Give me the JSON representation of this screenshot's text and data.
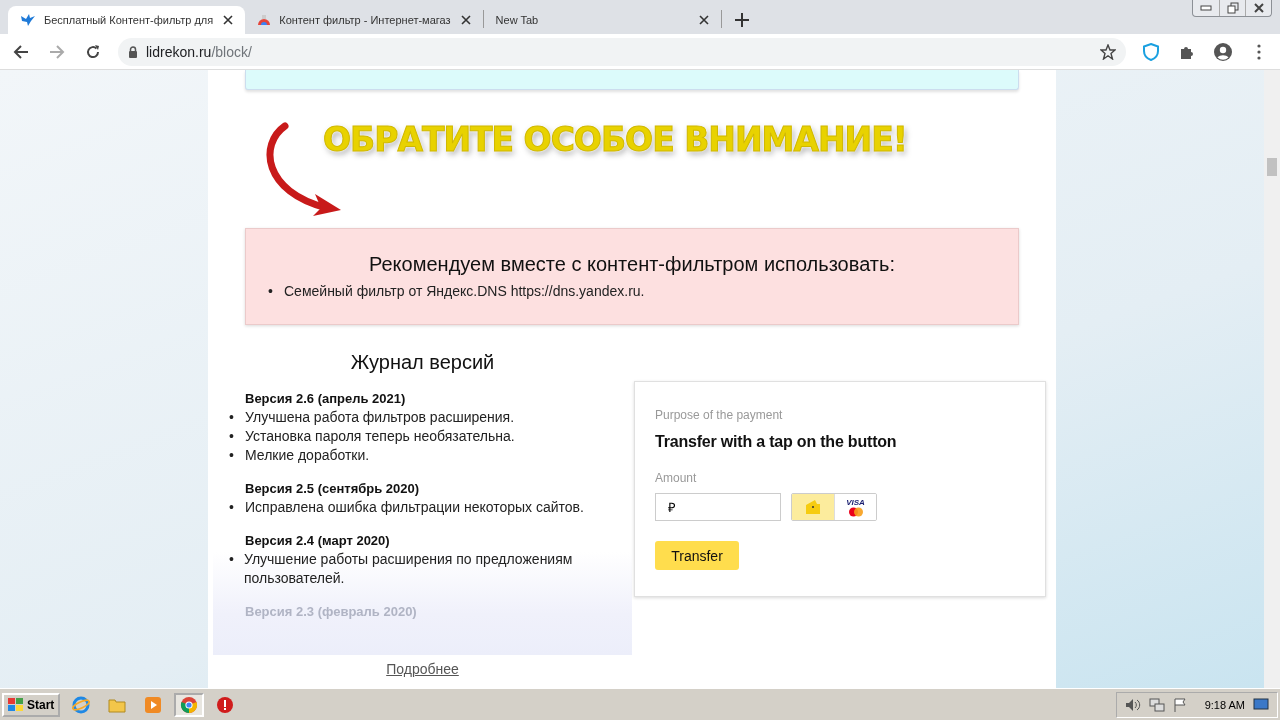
{
  "browser": {
    "tabs": [
      {
        "title": "Бесплатный Контент-фильтр для",
        "kind": "bird",
        "selected": true
      },
      {
        "title": "Контент фильтр - Интернет-магаз",
        "kind": "store",
        "selected": false
      },
      {
        "title": "New Tab",
        "kind": "blank",
        "selected": false
      }
    ],
    "address": {
      "host": "lidrekon.ru",
      "path": "/block/"
    }
  },
  "banner": {
    "text": "ОБРАТИТЕ ОСОБОЕ ВНИМАНИЕ!"
  },
  "recommend": {
    "bullet": "•",
    "title": "Рекомендуем вместе с контент-фильтром использовать:",
    "items": [
      "Семейный фильтр от Яндекс.DNS https://dns.yandex.ru."
    ]
  },
  "changelog": {
    "bullet": "•",
    "title": "Журнал версий",
    "versions": [
      {
        "heading": "Версия 2.6 (апрель 2021)",
        "items": [
          "Улучшена работа фильтров расширения.",
          "Установка пароля теперь необязательна.",
          "Мелкие доработки."
        ]
      },
      {
        "heading": "Версия 2.5 (сентябрь 2020)",
        "items": [
          "Исправлена ошибка фильтрации некоторых сайтов."
        ]
      },
      {
        "heading": "Версия 2.4 (март 2020)",
        "items": [
          "Улучшение работы расширения по предложениям пользователей."
        ]
      }
    ],
    "faded_heading": "Версия 2.3 (февраль 2020)",
    "more_link": "Подробнее"
  },
  "payment": {
    "purpose_label": "Purpose of the payment",
    "purpose": "Transfer with a tap on the button",
    "amount_label": "Amount",
    "currency": "₽",
    "methods": [
      {
        "kind": "wallet",
        "selected": true
      },
      {
        "kind": "card",
        "label": "VISA",
        "selected": false
      }
    ],
    "button": "Transfer"
  },
  "taskbar": {
    "start": "Start",
    "apps": [
      {
        "kind": "ie",
        "selected": false
      },
      {
        "kind": "folder",
        "selected": false
      },
      {
        "kind": "media",
        "selected": false
      },
      {
        "kind": "chrome",
        "selected": true
      },
      {
        "kind": "stop",
        "selected": false
      }
    ],
    "clock": "9:18 AM"
  }
}
